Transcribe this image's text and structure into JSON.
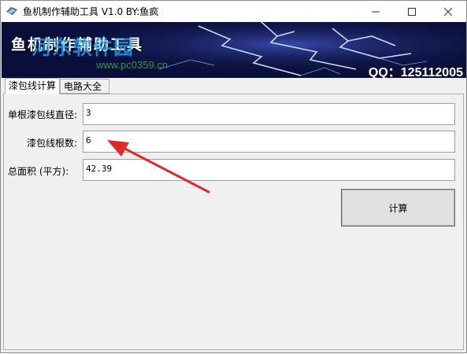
{
  "window": {
    "title": "鱼机制作辅助工具 V1.0   BY:鱼疯",
    "buttons": {
      "minimize": "—",
      "maximize": "☐",
      "close": "✕"
    }
  },
  "banner": {
    "title": "鱼机制作辅助工具",
    "qq": "QQ：125112005",
    "watermark": "河东软件园",
    "watermark_url": "www.pc0359.cn",
    "background_color": "#0a0f3a",
    "lightning_color": "#c9d8ff"
  },
  "tabs": [
    {
      "label": "漆包线计算",
      "active": true
    },
    {
      "label": "电路大全",
      "active": false
    }
  ],
  "form": {
    "diameter_label": "单根漆包线直径:",
    "diameter_value": "3",
    "count_label": "漆包线根数:",
    "count_value": "6",
    "area_label": "总面积 (平方):",
    "area_value": "42.39",
    "calc_button": "计算"
  },
  "annotation": {
    "arrow_color": "#e02a2a"
  }
}
